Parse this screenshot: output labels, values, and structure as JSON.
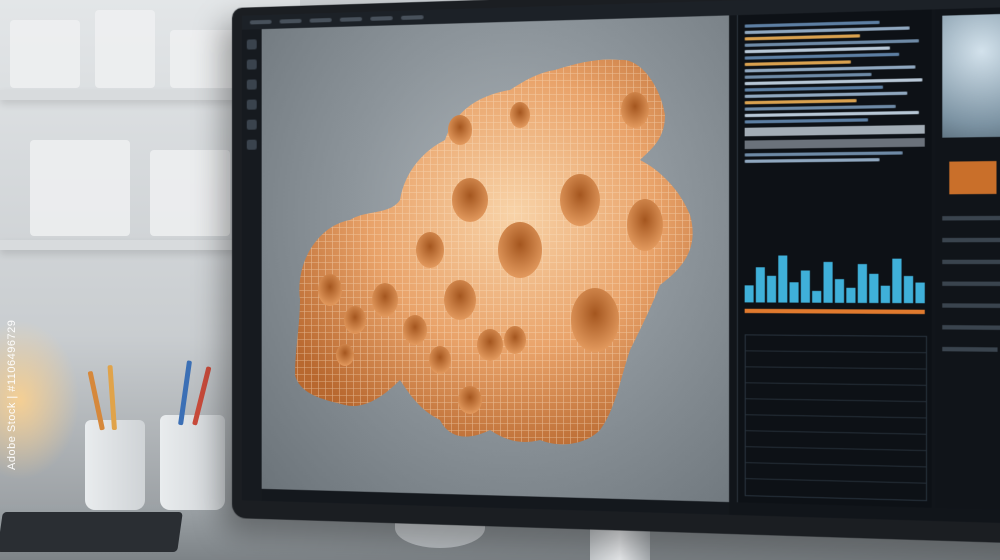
{
  "scene": {
    "subject": "3d-porous-organic-model",
    "colors": {
      "model_orange": "#e9a36a",
      "model_highlight": "#f6c99a",
      "model_shadow": "#b8682f",
      "screen_bg": "#11151a",
      "accent_blue": "#3fb0d9",
      "accent_orange": "#e07a2e"
    }
  },
  "watermark": {
    "vertical_id": "Adobe Stock | #1106496729"
  }
}
